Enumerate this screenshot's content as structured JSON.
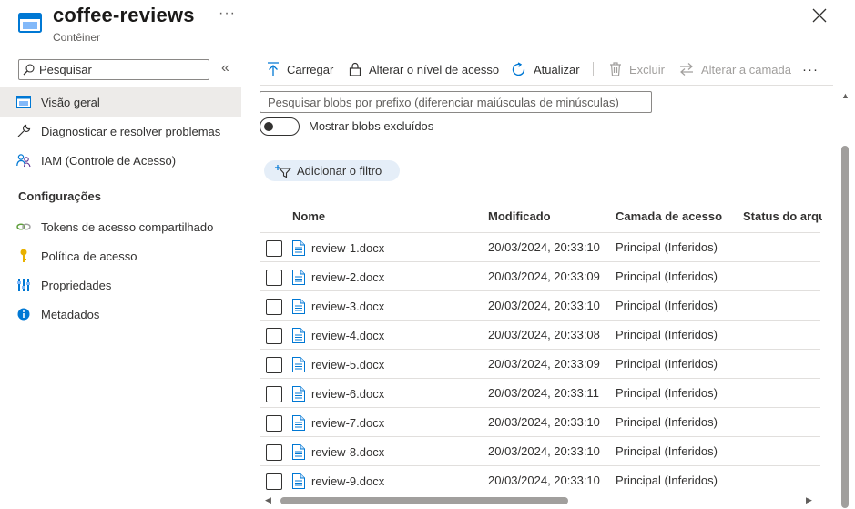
{
  "header": {
    "title": "coffee-reviews",
    "subtitle": "Contêiner",
    "more_label": "···"
  },
  "sidebar": {
    "search_placeholder": "Pesquisar",
    "collapse_label": "«",
    "items": [
      {
        "label": "Visão geral",
        "icon": "overview-icon",
        "active": true
      },
      {
        "label": "Diagnosticar e resolver problemas",
        "icon": "wrench-icon"
      },
      {
        "label": "IAM (Controle de Acesso)",
        "icon": "iam-people-icon"
      }
    ],
    "section_title": "Configurações",
    "settings_items": [
      {
        "label": "Tokens de acesso compartilhado",
        "icon": "link-icon"
      },
      {
        "label": "Política de acesso",
        "icon": "key-icon"
      },
      {
        "label": "Propriedades",
        "icon": "properties-icon"
      },
      {
        "label": "Metadados",
        "icon": "info-icon"
      }
    ]
  },
  "toolbar": {
    "upload": "Carregar",
    "access_level": "Alterar o nível de acesso",
    "refresh": "Atualizar",
    "delete": "Excluir",
    "change_tier": "Alterar a camada",
    "more": "···"
  },
  "main": {
    "search_placeholder": "Pesquisar blobs por prefixo (diferenciar maiúsculas de minúsculas)",
    "toggle_label": "Mostrar blobs excluídos",
    "filter_label": "Adicionar o filtro"
  },
  "table": {
    "columns": [
      "Nome",
      "Modificado",
      "Camada de acesso",
      "Status do arquivamento"
    ],
    "rows": [
      {
        "name": "review-1.docx",
        "modified": "20/03/2024, 20:33:10",
        "tier": "Principal (Inferidos)"
      },
      {
        "name": "review-2.docx",
        "modified": "20/03/2024, 20:33:09",
        "tier": "Principal (Inferidos)"
      },
      {
        "name": "review-3.docx",
        "modified": "20/03/2024, 20:33:10",
        "tier": "Principal (Inferidos)"
      },
      {
        "name": "review-4.docx",
        "modified": "20/03/2024, 20:33:08",
        "tier": "Principal (Inferidos)"
      },
      {
        "name": "review-5.docx",
        "modified": "20/03/2024, 20:33:09",
        "tier": "Principal (Inferidos)"
      },
      {
        "name": "review-6.docx",
        "modified": "20/03/2024, 20:33:11",
        "tier": "Principal (Inferidos)"
      },
      {
        "name": "review-7.docx",
        "modified": "20/03/2024, 20:33:10",
        "tier": "Principal (Inferidos)"
      },
      {
        "name": "review-8.docx",
        "modified": "20/03/2024, 20:33:10",
        "tier": "Principal (Inferidos)"
      },
      {
        "name": "review-9.docx",
        "modified": "20/03/2024, 20:33:10",
        "tier": "Principal (Inferidos)"
      }
    ]
  },
  "colors": {
    "accent": "#0078d4",
    "active_bg": "#edebe9",
    "filter_pill_bg": "#e5eef8",
    "key_yellow": "#e8b100"
  }
}
